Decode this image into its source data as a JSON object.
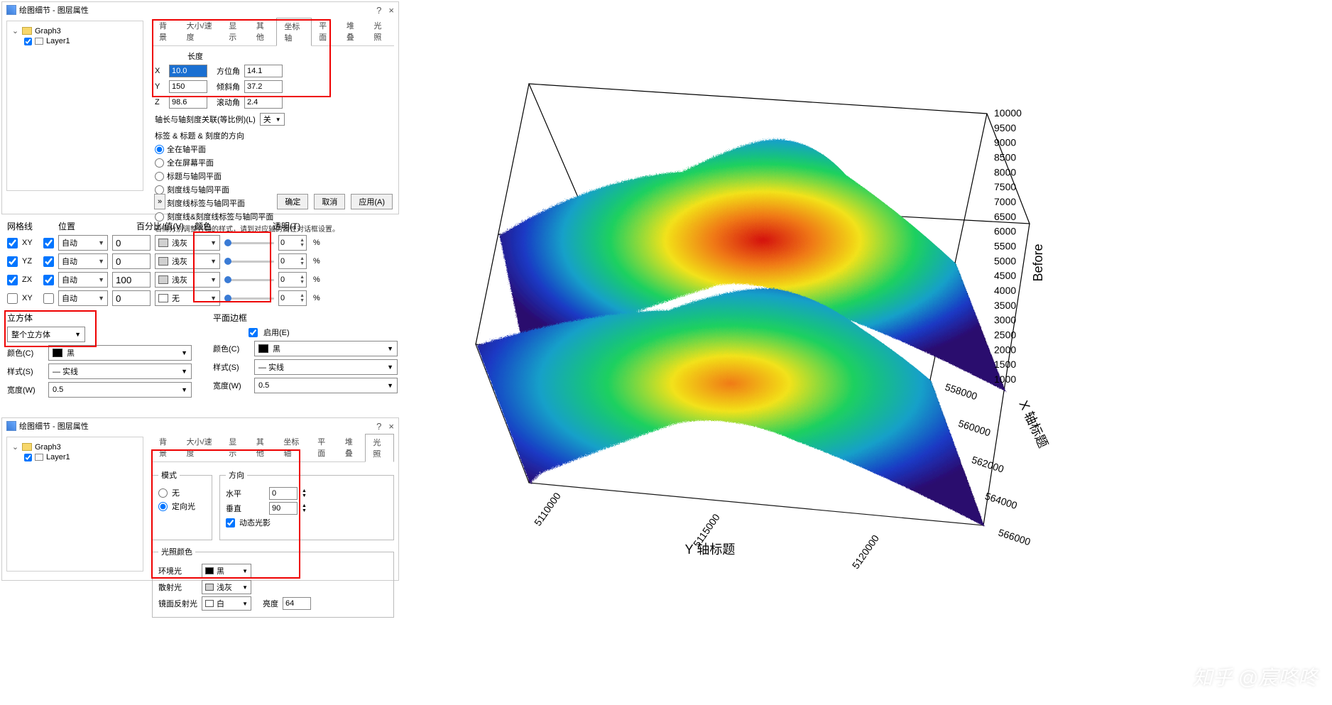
{
  "win1": {
    "title": "绘图细节 - 图层属性",
    "help": "?",
    "close": "×",
    "tree": {
      "root": "Graph3",
      "child": "Layer1"
    },
    "tabs": [
      "背景",
      "大小/速度",
      "显示",
      "其他",
      "坐标轴",
      "平面",
      "堆叠",
      "光照"
    ],
    "activeTab": 4,
    "axisLen": {
      "heading": "长度",
      "rows": [
        {
          "axis": "X",
          "len": "10.0",
          "angleLabel": "方位角",
          "angle": "14.1",
          "lenSelected": true
        },
        {
          "axis": "Y",
          "len": "150",
          "angleLabel": "倾斜角",
          "angle": "37.2"
        },
        {
          "axis": "Z",
          "len": "98.6",
          "angleLabel": "滚动角",
          "angle": "2.4"
        }
      ],
      "ratioLabel": "轴长与轴刻度关联(等比例)(L)",
      "ratioState": "关"
    },
    "orient": {
      "heading": "标签 & 标题 & 刻度的方向",
      "options": [
        "全在轴平面",
        "全在屏幕平面",
        "标题与轴同平面",
        "刻度线与轴同平面",
        "刻度线标签与轴同平面",
        "刻度线&刻度线标签与轴同平面"
      ],
      "selected": 0,
      "note": "若需分别调整各轴的样式，请到对应轴的属性对话框设置。"
    },
    "footer": {
      "more": "»",
      "ok": "确定",
      "cancel": "取消",
      "apply": "应用(A)"
    }
  },
  "gridlines": {
    "headers": {
      "grid": "网格线",
      "pos": "位置",
      "pct": "百分比/值(V)",
      "color": "颜色",
      "trans": "透明(T)"
    },
    "rows": [
      {
        "label": "XY",
        "on": true,
        "posOn": true,
        "pos": "自动",
        "pct": "0",
        "color": "浅灰",
        "swatch": "#d0d0d0",
        "trans": "0"
      },
      {
        "label": "YZ",
        "on": true,
        "posOn": true,
        "pos": "自动",
        "pct": "0",
        "color": "浅灰",
        "swatch": "#d0d0d0",
        "trans": "0"
      },
      {
        "label": "ZX",
        "on": true,
        "posOn": true,
        "pos": "自动",
        "pct": "100",
        "color": "浅灰",
        "swatch": "#d0d0d0",
        "trans": "0"
      },
      {
        "label": "XY",
        "on": false,
        "posOn": false,
        "pos": "自动",
        "pct": "0",
        "color": "无",
        "swatch": "#ffffff",
        "trans": "0"
      }
    ]
  },
  "cube": {
    "title": "立方体",
    "mode": "整个立方体",
    "colorLabel": "颜色(C)",
    "color": "黑",
    "colorSwatch": "#000000",
    "styleLabel": "样式(S)",
    "style": "— 实线",
    "widthLabel": "宽度(W)",
    "width": "0.5"
  },
  "planeFrame": {
    "title": "平面边框",
    "enable": "启用(E)",
    "enabled": true,
    "colorLabel": "颜色(C)",
    "color": "黑",
    "colorSwatch": "#000000",
    "styleLabel": "样式(S)",
    "style": "— 实线",
    "widthLabel": "宽度(W)",
    "width": "0.5"
  },
  "win2": {
    "title": "绘图细节 - 图层属性",
    "tabs": [
      "背景",
      "大小/速度",
      "显示",
      "其他",
      "坐标轴",
      "平面",
      "堆叠",
      "光照"
    ],
    "activeTab": 7,
    "mode": {
      "title": "模式",
      "none": "无",
      "directional": "定向光",
      "selected": 1
    },
    "direction": {
      "title": "方向",
      "hLabel": "水平",
      "h": "0",
      "vLabel": "垂直",
      "v": "90",
      "dyn": "动态光影",
      "dynOn": true
    },
    "lightColor": {
      "title": "光照颜色",
      "ambient": "环境光",
      "ambientColor": "黑",
      "ambientSwatch": "#000000",
      "diffuse": "散射光",
      "diffuseColor": "浅灰",
      "diffuseSwatch": "#d0d0d0",
      "specular": "镜面反射光",
      "specularColor": "白",
      "specularSwatch": "#ffffff",
      "brightLabel": "亮度",
      "bright": "64"
    }
  },
  "chart_data": {
    "type": "3d-surface",
    "x_axis": {
      "label": "X 轴标题",
      "ticks": [
        558000,
        560000,
        562000,
        564000,
        566000
      ]
    },
    "y_axis": {
      "label": "Y 轴标题",
      "ticks": [
        5110000,
        5115000,
        5120000
      ]
    },
    "z_axis": {
      "label": "Before",
      "ticks": [
        1000,
        1500,
        2000,
        2500,
        3000,
        3500,
        4000,
        4500,
        5000,
        5500,
        6000,
        6500,
        7000,
        7500,
        8000,
        8500,
        9000,
        9500,
        10000
      ]
    },
    "colormap": "rainbow",
    "surfaces": 2,
    "description": "Two stacked 3D colored surface plots of terrain/DEM with a central peak; rainbow colormap from purple (low) to red (high)."
  },
  "watermark": "知乎 @宸咚咚"
}
